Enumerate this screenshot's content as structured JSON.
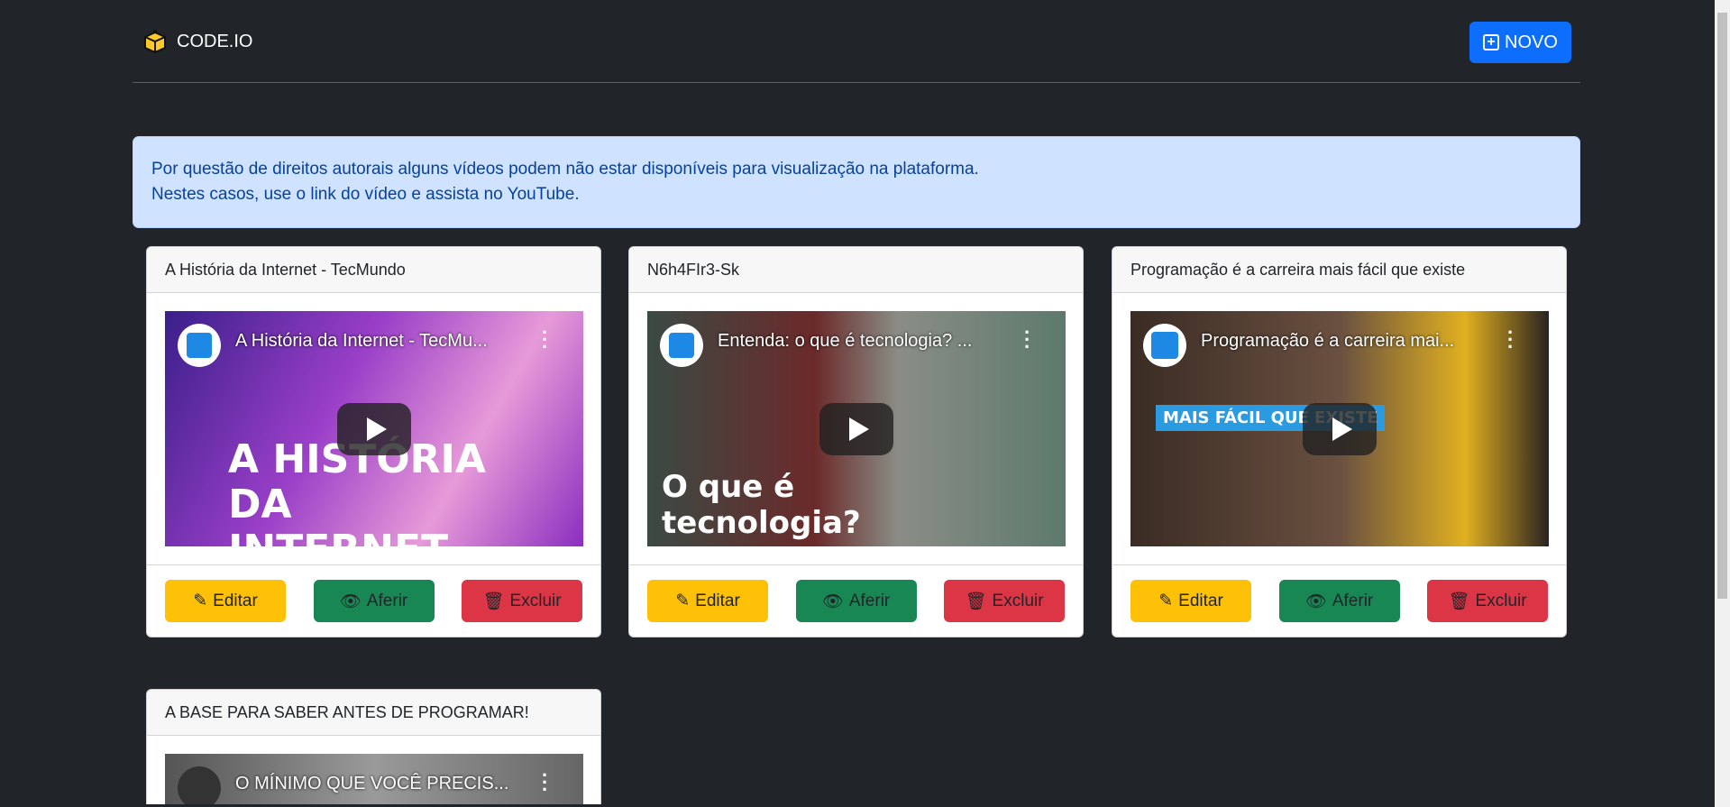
{
  "header": {
    "brand": "CODE.IO",
    "new_button": "NOVO"
  },
  "alert": {
    "line1": "Por questão de direitos autorais alguns vídeos podem não estar disponíveis para visualização na plataforma.",
    "line2": "Nestes casos, use o link do vídeo e assista no YouTube."
  },
  "cards": [
    {
      "title": "A História da Internet - TecMundo",
      "video_title": "A História da Internet - TecMu...",
      "thumb_text": "A HISTÓRIA DA INTERNET"
    },
    {
      "title": "N6h4FIr3-Sk",
      "video_title": "Entenda: o que é tecnologia? ...",
      "thumb_text": "O que é tecnologia?"
    },
    {
      "title": "Programação é a carreira mais fácil que existe",
      "video_title": "Programação é a carreira mai...",
      "thumb_text": "MAIS FÁCIL QUE EXISTE"
    },
    {
      "title": "A BASE PARA SABER ANTES DE PROGRAMAR!",
      "video_title": "O MÍNIMO QUE VOCÊ PRECIS..."
    }
  ],
  "actions": {
    "edit": "Editar",
    "view": "Aferir",
    "delete": "Excluir"
  },
  "colors": {
    "primary": "#0d6efd",
    "warning": "#ffc107",
    "success": "#198754",
    "danger": "#dc3545",
    "background": "#212529"
  }
}
